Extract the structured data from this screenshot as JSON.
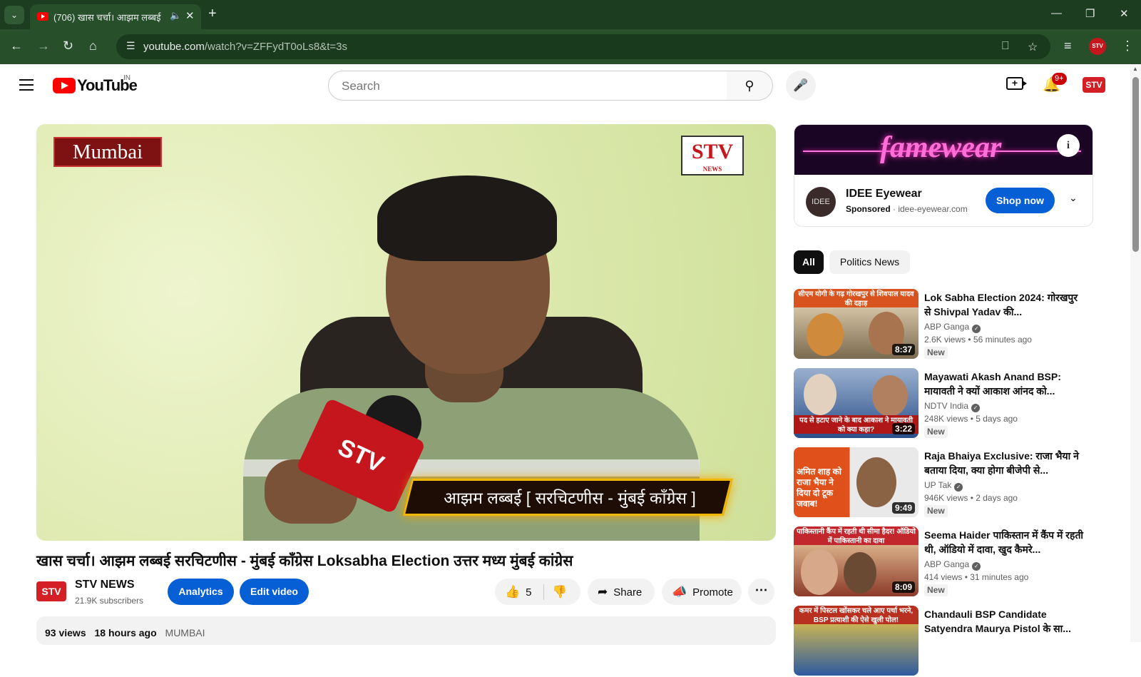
{
  "browser": {
    "tab_title": "(706) खास चर्चा। आझम लब्बई",
    "url_host": "youtube.com",
    "url_path": "/watch?v=ZFFydT0oLs8&t=3s",
    "profile_label": "STV"
  },
  "header": {
    "logo_text": "YouTube",
    "country_code": "IN",
    "search_placeholder": "Search",
    "notif_count": "9+",
    "avatar_label": "STV"
  },
  "player": {
    "city_tag": "Mumbai",
    "watermark_main": "STV",
    "watermark_sub": "NEWS",
    "mic_label": "STV",
    "lower_third": "आझम लब्बई [ सरचिटणीस - मुंबई काँग्रेस ]"
  },
  "video": {
    "title": "खास चर्चा। आझम लब्बई  सरचिटणीस - मुंबई काँग्रेस Loksabha Election उत्तर मध्य मुंबई कांग्रेस",
    "channel_avatar": "STV",
    "channel_name": "STV NEWS",
    "subscribers": "21.9K subscribers",
    "analytics_label": "Analytics",
    "edit_label": "Edit video",
    "like_count": "5",
    "share_label": "Share",
    "promote_label": "Promote",
    "views": "93 views",
    "posted": "18 hours ago",
    "location_tag": "MUMBAI"
  },
  "ad": {
    "banner_text": "famewear",
    "logo_text": "IDEE",
    "advertiser": "IDEE Eyewear",
    "sponsored": "Sponsored",
    "domain": "idee-eyewear.com",
    "cta": "Shop now"
  },
  "chips": [
    {
      "label": "All"
    },
    {
      "label": "Politics News"
    }
  ],
  "recommendations": [
    {
      "title": "Lok Sabha Election 2024: गोरखपुर से Shivpal Yadav की...",
      "channel": "ABP Ganga",
      "views": "2.6K views",
      "age": "56 minutes ago",
      "badge": "New",
      "duration": "8:37",
      "thumb_caption": "सीएम योगी के गढ़ गोरखपुर से शिवपाल यादव की दहाड़",
      "thumb_color": "#d9531e"
    },
    {
      "title": "Mayawati Akash Anand BSP: मायावती ने क्यों आकाश आंनद को...",
      "channel": "NDTV India",
      "views": "248K views",
      "age": "5 days ago",
      "badge": "New",
      "duration": "3:22",
      "thumb_caption": "पद से हटाए जाने के बाद आकाश ने मायावती को क्या कहा?",
      "thumb_color": "#2b4f8a"
    },
    {
      "title": "Raja Bhaiya Exclusive: राजा भैया ने बताया दिया, क्या होगा बीजेपी से...",
      "channel": "UP Tak",
      "views": "946K views",
      "age": "2 days ago",
      "badge": "New",
      "duration": "9:49",
      "thumb_caption": "अमित शाह को राजा भैया ने दिया दो टूक जवाब!",
      "thumb_color": "#e0501a"
    },
    {
      "title": "Seema Haider पाकिस्तान में कैंप में रहती थी, ऑडियो में दावा, खुद कैमरे...",
      "channel": "ABP Ganga",
      "views": "414 views",
      "age": "31 minutes ago",
      "badge": "New",
      "duration": "8:09",
      "thumb_caption": "पाकिस्तानी कैंप में रहती थी सीमा हैदर! ऑडियो में पाकिस्तानी का दावा",
      "thumb_color": "#c2272d"
    },
    {
      "title": "Chandauli BSP Candidate Satyendra Maurya Pistol के सा...",
      "channel": "",
      "views": "",
      "age": "",
      "badge": "",
      "duration": "",
      "thumb_caption": "कमर में पिस्टल खोंसकर चले आए पर्चा भरने, BSP प्रत्याशी की ऐसे खुली पोल!",
      "thumb_color": "#b8301f"
    }
  ]
}
